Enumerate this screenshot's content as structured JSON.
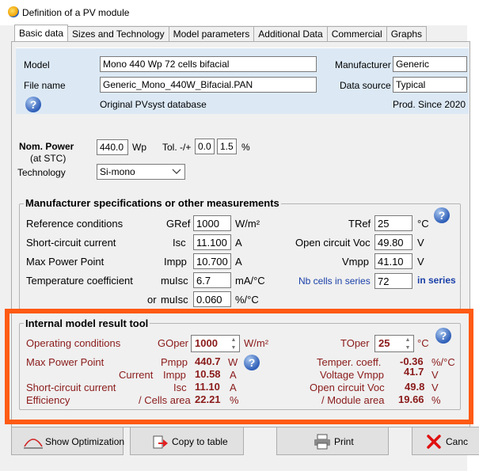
{
  "window": {
    "title": "Definition of a PV module"
  },
  "tabs": [
    {
      "label": "Basic data"
    },
    {
      "label": "Sizes and Technology"
    },
    {
      "label": "Model parameters"
    },
    {
      "label": "Additional Data"
    },
    {
      "label": "Commercial"
    },
    {
      "label": "Graphs"
    }
  ],
  "header": {
    "model_label": "Model",
    "model_value": "Mono 440 Wp 72 cells bifacial",
    "manufacturer_label": "Manufacturer",
    "manufacturer_value": "Generic",
    "filename_label": "File name",
    "filename_value": "Generic_Mono_440W_Bifacial.PAN",
    "datasource_label": "Data source",
    "datasource_value": "Typical",
    "database_text": "Original PVsyst database",
    "prod_since_text": "Prod. Since 2020"
  },
  "power": {
    "nom_label": "Nom. Power",
    "stc_label": "(at STC)",
    "value": "440.0",
    "unit": "Wp",
    "tol_label": "Tol. -/+",
    "tol_minus": "0.0",
    "tol_plus": "1.5",
    "tol_unit": "%",
    "tech_label": "Technology",
    "tech_value": "Si-mono"
  },
  "specs": {
    "title": "Manufacturer specifications or other measurements",
    "ref_label": "Reference conditions",
    "gref_label": "GRef",
    "gref_value": "1000",
    "gref_unit": "W/m²",
    "tref_label": "TRef",
    "tref_value": "25",
    "tref_unit": "°C",
    "isc_row_label": "Short-circuit current",
    "isc_label": "Isc",
    "isc_value": "11.100",
    "isc_unit": "A",
    "voc_label": "Open circuit Voc",
    "voc_value": "49.80",
    "voc_unit": "V",
    "mpp_row_label": "Max Power Point",
    "impp_label": "Impp",
    "impp_value": "10.700",
    "impp_unit": "A",
    "vmpp_label": "Vmpp",
    "vmpp_value": "41.10",
    "vmpp_unit": "V",
    "temp_row_label": "Temperature coefficient",
    "muisc_label": "muIsc",
    "muisc_value": "6.7",
    "muisc_unit": "mA/°C",
    "cells_label": "Nb cells in series",
    "cells_value": "72",
    "cells_unit": "in series",
    "or_label": "or",
    "muisc2_label": "muIsc",
    "muisc2_value": "0.060",
    "muisc2_unit": "%/°C"
  },
  "model_tool": {
    "title": "Internal model result tool",
    "op_label": "Operating conditions",
    "goper_label": "GOper",
    "goper_value": "1000",
    "goper_unit": "W/m²",
    "toper_label": "TOper",
    "toper_value": "25",
    "toper_unit": "°C",
    "mpp_label": "Max Power Point",
    "pmpp_label": "Pmpp",
    "pmpp_value": "440.7",
    "pmpp_unit": "W",
    "temper_label": "Temper. coeff.",
    "temper_value": "-0.36",
    "temper_unit": "%/°C",
    "current_label": "Current",
    "impp_label": "Impp",
    "impp_value": "10.58",
    "impp_unit": "A",
    "vmpp_label": "Voltage Vmpp",
    "vmpp_value": "41.7",
    "vmpp_unit": "V",
    "isc_row_label": "Short-circuit current",
    "isc_label": "Isc",
    "isc_value": "11.10",
    "isc_unit": "A",
    "voc_label": "Open circuit Voc",
    "voc_value": "49.8",
    "voc_unit": "V",
    "eff_label": "Efficiency",
    "cells_area_label": "/ Cells area",
    "cells_area_value": "22.21",
    "cells_area_unit": "%",
    "module_area_label": "/ Module area",
    "module_area_value": "19.66",
    "module_area_unit": "%"
  },
  "buttons": {
    "optimization": "Show Optimization",
    "copy": "Copy to table",
    "print": "Print",
    "cancel": "Canc"
  },
  "colors": {
    "accent_frame": "#ff5a14",
    "dark_red": "#8a1a1a",
    "blue": "#1a3fa8",
    "band": "#dce9f5"
  }
}
